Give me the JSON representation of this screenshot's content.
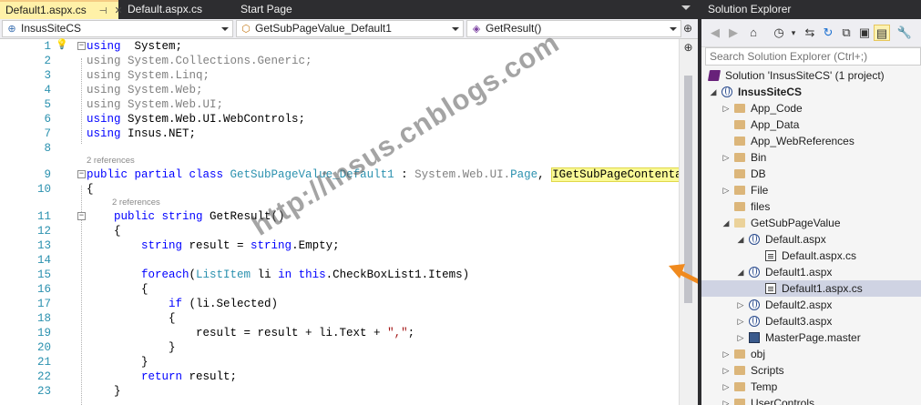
{
  "tabs": [
    {
      "label": "Default1.aspx.cs",
      "pin": "⊣",
      "close": "✕"
    },
    {
      "label": "Default.aspx.cs"
    },
    {
      "label": "Start Page"
    }
  ],
  "nav": {
    "project": "InsusSiteCS",
    "type": "GetSubPageValue_Default1",
    "member": "GetResult()"
  },
  "code": {
    "refs_class": "2 references",
    "refs_method": "2 references",
    "lines": [
      {
        "n": "1",
        "tokens": [
          [
            "kw",
            "using"
          ],
          [
            "",
            "  System;"
          ]
        ]
      },
      {
        "n": "2",
        "tokens": [
          [
            "gr",
            "using System.Collections.Generic;"
          ]
        ]
      },
      {
        "n": "3",
        "tokens": [
          [
            "gr",
            "using System.Linq;"
          ]
        ]
      },
      {
        "n": "4",
        "tokens": [
          [
            "gr",
            "using System.Web;"
          ]
        ]
      },
      {
        "n": "5",
        "tokens": [
          [
            "gr",
            "using System.Web.UI;"
          ]
        ]
      },
      {
        "n": "6",
        "tokens": [
          [
            "kw",
            "using"
          ],
          [
            "",
            " System.Web.UI.WebControls;"
          ]
        ]
      },
      {
        "n": "7",
        "tokens": [
          [
            "kw",
            "using"
          ],
          [
            "",
            " Insus.NET;"
          ]
        ]
      },
      {
        "n": "8",
        "tokens": []
      },
      {
        "n": "9",
        "tokens": [
          [
            "kw",
            "public partial class"
          ],
          [
            "",
            " "
          ],
          [
            "ty",
            "GetSubPageValue_Default1"
          ],
          [
            "",
            " : "
          ],
          [
            "gr",
            "System.Web.UI."
          ],
          [
            "ty",
            "Page"
          ],
          [
            "",
            ", "
          ],
          [
            "hl",
            "IGetSubPageContentable"
          ]
        ]
      },
      {
        "n": "10",
        "tokens": [
          [
            "",
            "{"
          ]
        ]
      },
      {
        "n": "11",
        "tokens": [
          [
            "",
            "    "
          ],
          [
            "kw",
            "public string"
          ],
          [
            "",
            " GetResult()"
          ]
        ]
      },
      {
        "n": "12",
        "tokens": [
          [
            "",
            "    {"
          ]
        ]
      },
      {
        "n": "13",
        "tokens": [
          [
            "",
            "        "
          ],
          [
            "kw",
            "string"
          ],
          [
            "",
            " result = "
          ],
          [
            "kw",
            "string"
          ],
          [
            "",
            ".Empty;"
          ]
        ]
      },
      {
        "n": "14",
        "tokens": []
      },
      {
        "n": "15",
        "tokens": [
          [
            "",
            "        "
          ],
          [
            "kw",
            "foreach"
          ],
          [
            "",
            "("
          ],
          [
            "ty",
            "ListItem"
          ],
          [
            "",
            " li "
          ],
          [
            "kw",
            "in"
          ],
          [
            "",
            " "
          ],
          [
            "kw",
            "this"
          ],
          [
            "",
            ".CheckBoxList1.Items)"
          ]
        ]
      },
      {
        "n": "16",
        "tokens": [
          [
            "",
            "        {"
          ]
        ]
      },
      {
        "n": "17",
        "tokens": [
          [
            "",
            "            "
          ],
          [
            "kw",
            "if"
          ],
          [
            "",
            " (li.Selected)"
          ]
        ]
      },
      {
        "n": "18",
        "tokens": [
          [
            "",
            "            {"
          ]
        ]
      },
      {
        "n": "19",
        "tokens": [
          [
            "",
            "                result = result + li.Text + "
          ],
          [
            "st",
            "\",\""
          ],
          [
            "",
            ";"
          ]
        ]
      },
      {
        "n": "20",
        "tokens": [
          [
            "",
            "            }"
          ]
        ]
      },
      {
        "n": "21",
        "tokens": [
          [
            "",
            "        }"
          ]
        ]
      },
      {
        "n": "22",
        "tokens": [
          [
            "",
            "        "
          ],
          [
            "kw",
            "return"
          ],
          [
            "",
            " result;"
          ]
        ]
      },
      {
        "n": "23",
        "tokens": [
          [
            "",
            "    }"
          ]
        ]
      }
    ]
  },
  "watermark": "http://insus.cnblogs.com",
  "solution_explorer": {
    "title": "Solution Explorer",
    "search_placeholder": "Search Solution Explorer (Ctrl+;)",
    "tree": [
      {
        "label": "Solution 'InsusSiteCS' (1 project)",
        "icon": "sln",
        "expander": ""
      },
      {
        "label": "InsusSiteCS",
        "icon": "globe",
        "expander": "◢",
        "bold": true
      },
      {
        "label": "App_Code",
        "icon": "folder",
        "expander": "▷"
      },
      {
        "label": "App_Data",
        "icon": "folder",
        "expander": ""
      },
      {
        "label": "App_WebReferences",
        "icon": "folder",
        "expander": ""
      },
      {
        "label": "Bin",
        "icon": "folder",
        "expander": "▷"
      },
      {
        "label": "DB",
        "icon": "folder",
        "expander": ""
      },
      {
        "label": "File",
        "icon": "folder",
        "expander": "▷"
      },
      {
        "label": "files",
        "icon": "folder",
        "expander": ""
      },
      {
        "label": "GetSubPageValue",
        "icon": "folder-open",
        "expander": "◢"
      },
      {
        "label": "Default.aspx",
        "icon": "globe",
        "expander": "◢"
      },
      {
        "label": "Default.aspx.cs",
        "icon": "doc",
        "expander": ""
      },
      {
        "label": "Default1.aspx",
        "icon": "globe",
        "expander": "◢"
      },
      {
        "label": "Default1.aspx.cs",
        "icon": "doc",
        "expander": "",
        "selected": true
      },
      {
        "label": "Default2.aspx",
        "icon": "globe",
        "expander": "▷"
      },
      {
        "label": "Default3.aspx",
        "icon": "globe",
        "expander": "▷"
      },
      {
        "label": "MasterPage.master",
        "icon": "master",
        "expander": "▷"
      },
      {
        "label": "obj",
        "icon": "folder",
        "expander": "▷"
      },
      {
        "label": "Scripts",
        "icon": "folder",
        "expander": "▷"
      },
      {
        "label": "Temp",
        "icon": "folder",
        "expander": "▷"
      },
      {
        "label": "UserControls",
        "icon": "folder",
        "expander": "▷"
      }
    ]
  },
  "icons": {
    "project": "csharp-project-icon",
    "type": "class-icon",
    "member": "method-icon",
    "bulb": "lightbulb-icon"
  },
  "colors": {
    "keyword": "#0000ff",
    "type": "#2b91af",
    "string": "#a31515",
    "highlight": "#fafa96",
    "arrow": "#f08a1e",
    "active_tab": "#fff1a8"
  }
}
